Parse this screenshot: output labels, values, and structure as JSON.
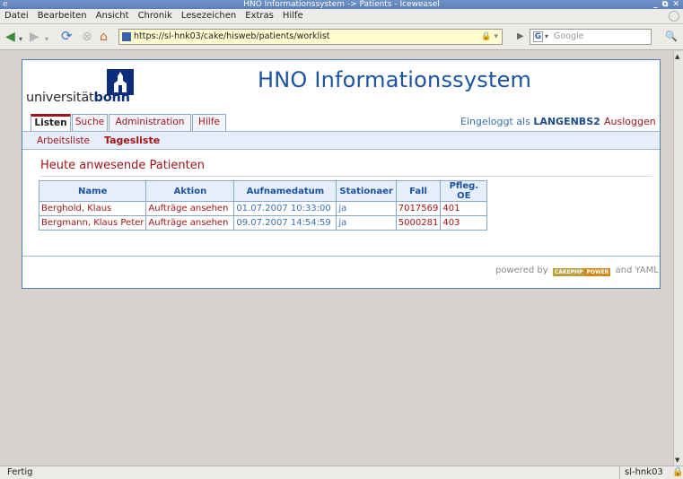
{
  "window": {
    "title": "HNO Informationssystem -> Patients - Iceweasel",
    "controls": "_ ⧉ ✕"
  },
  "menubar": {
    "items": [
      "Datei",
      "Bearbeiten",
      "Ansicht",
      "Chronik",
      "Lesezeichen",
      "Extras",
      "Hilfe"
    ]
  },
  "toolbar": {
    "url": "https://sl-hnk03/cake/hisweb/patients/worklist",
    "search_placeholder": "Google",
    "search_engine_glyph": "G"
  },
  "site": {
    "logo_prefix": "universität",
    "logo_bold": "bonn",
    "title": "HNO Informationssystem"
  },
  "tabs": [
    {
      "label": "Listen",
      "active": true
    },
    {
      "label": "Suche",
      "active": false
    },
    {
      "label": "Administration",
      "active": false
    },
    {
      "label": "Hilfe",
      "active": false
    }
  ],
  "session": {
    "logged_in_prefix": "Eingeloggt als",
    "username": "LANGENBS2",
    "logout": "Ausloggen"
  },
  "subnav": {
    "items": [
      {
        "label": "Arbeitsliste",
        "active": false
      },
      {
        "label": "Tagesliste",
        "active": true
      }
    ]
  },
  "section": {
    "title": "Heute anwesende Patienten"
  },
  "patients": {
    "columns": [
      "Name",
      "Aktion",
      "Aufnamedatum",
      "Stationaer",
      "Fall",
      "Pfleg. OE"
    ],
    "rows": [
      {
        "name": "Berghold, Klaus",
        "action": "Aufträge ansehen",
        "date": "01.07.2007 10:33:00",
        "stationaer": "ja",
        "fall": "7017569",
        "oe": "401"
      },
      {
        "name": "Bergmann, Klaus Peter",
        "action": "Aufträge ansehen",
        "date": "09.07.2007 14:54:59",
        "stationaer": "ja",
        "fall": "5000281",
        "oe": "403"
      }
    ]
  },
  "footer": {
    "powered_by": "powered by",
    "badge_left": "CAKEPHP",
    "badge_right": "POWER",
    "and_yaml": "and YAML"
  },
  "status": {
    "text": "Fertig",
    "host": "sl-hnk03"
  },
  "colors": {
    "brand_blue": "#1c53a0",
    "link_red": "#a3141a",
    "uni_navy": "#0b2d7c",
    "url_bar_bg": "#fffcd0"
  }
}
